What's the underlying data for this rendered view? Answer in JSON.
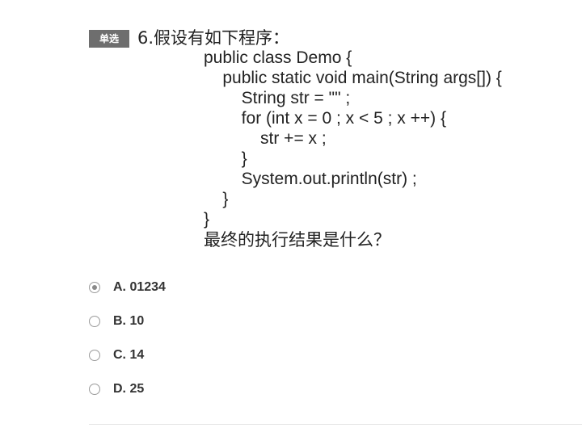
{
  "question": {
    "type_badge": "单选",
    "title": "6.假设有如下程序：",
    "code_lines": [
      "public class Demo {",
      "    public static void main(String args[]) {",
      "        String str = \"\" ;",
      "        for (int x = 0 ; x < 5 ; x ++) {",
      "            str += x ;",
      "        }",
      "        System.out.println(str) ;",
      "    }",
      "}"
    ],
    "ending": "最终的执行结果是什么？"
  },
  "options": [
    {
      "label": "A. 01234",
      "selected": true
    },
    {
      "label": "B. 10",
      "selected": false
    },
    {
      "label": "C. 14",
      "selected": false
    },
    {
      "label": "D. 25",
      "selected": false
    }
  ]
}
